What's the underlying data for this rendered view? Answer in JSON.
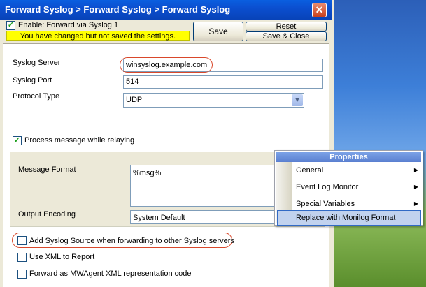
{
  "window": {
    "title": "Forward Syslog > Forward Syslog > Forward Syslog",
    "close_glyph": "✕"
  },
  "toolbar": {
    "enable_label": "Enable: Forward via Syslog 1",
    "enable_checked": true,
    "warning": "You have changed but not saved the settings.",
    "save_label": "Save",
    "reset_label": "Reset",
    "save_close_label": "Save & Close"
  },
  "form": {
    "syslog_server_label": "Syslog Server",
    "syslog_server_value": "winsyslog.example.com",
    "syslog_port_label": "Syslog Port",
    "syslog_port_value": "514",
    "protocol_type_label": "Protocol Type",
    "protocol_type_value": "UDP",
    "process_relay_label": "Process message while relaying",
    "process_relay_checked": true,
    "message_format_label": "Message Format",
    "message_format_value": "%msg%",
    "output_encoding_label": "Output Encoding",
    "output_encoding_value": "System Default",
    "add_source_label": "Add Syslog Source when forwarding to other Syslog servers",
    "add_source_checked": false,
    "use_xml_label": "Use XML to Report",
    "use_xml_checked": false,
    "mwagent_label": "Forward as MWAgent XML representation code",
    "mwagent_checked": false
  },
  "context_menu": {
    "header": "Properties",
    "items": [
      {
        "label": "General",
        "submenu": true
      },
      {
        "label": "Event Log Monitor",
        "submenu": true
      },
      {
        "label": "Special Variables",
        "submenu": true
      },
      {
        "label": "Replace with Monilog Format",
        "submenu": false,
        "selected": true
      }
    ]
  },
  "colors": {
    "title_bar": "#0b4fd0",
    "warning_bg": "#ffff00",
    "highlight_oval": "#d9482b",
    "menu_selected": "#c1d2ee"
  },
  "icons": {
    "close": "close-icon",
    "checkbox_checked": "check-icon",
    "dropdown": "chevron-down-icon",
    "submenu": "chevron-right-icon"
  }
}
